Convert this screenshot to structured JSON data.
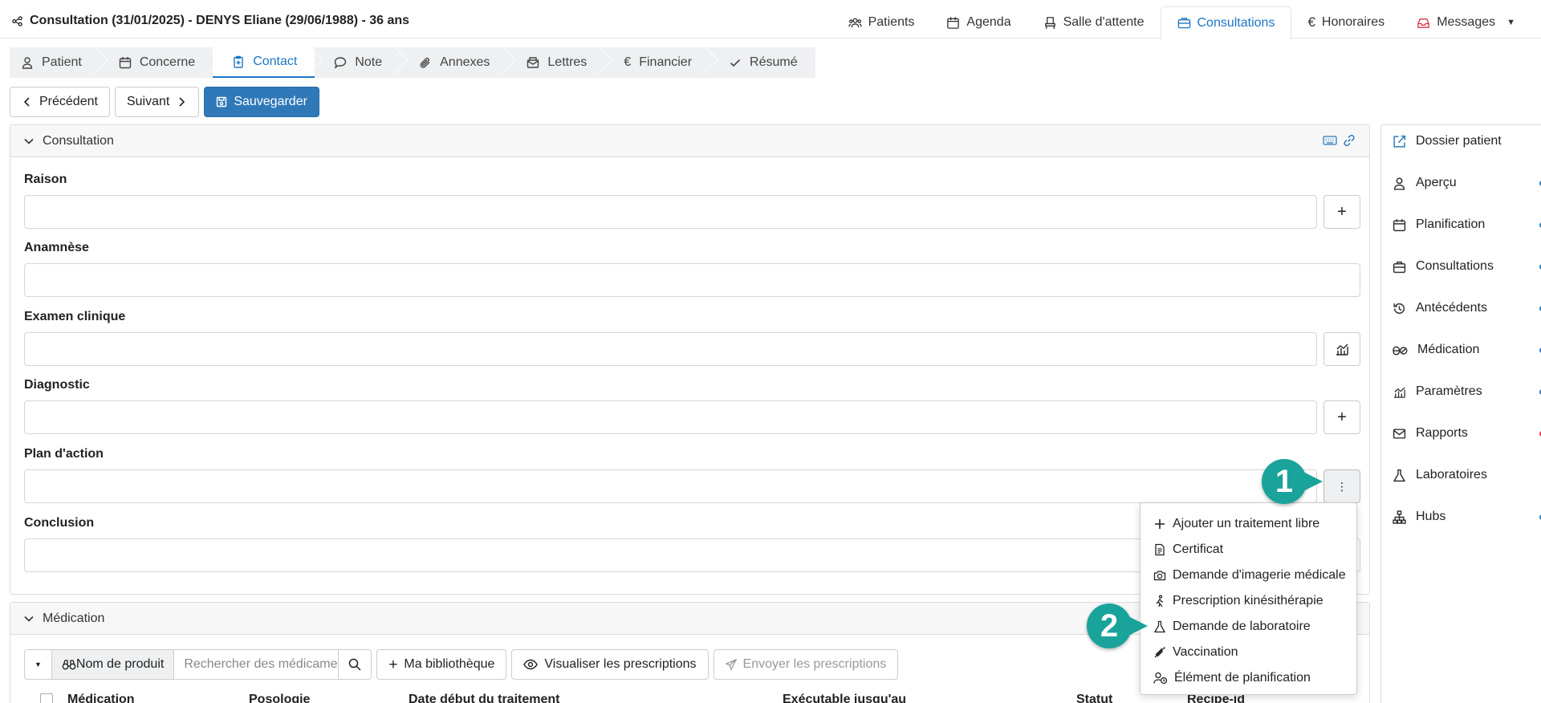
{
  "header": {
    "title": "Consultation (31/01/2025) - DENYS Eliane (29/06/1988) - 36 ans",
    "nav": [
      {
        "label": "Patients",
        "icon": "users-icon"
      },
      {
        "label": "Agenda",
        "icon": "calendar-icon"
      },
      {
        "label": "Salle d'attente",
        "icon": "chair-icon"
      },
      {
        "label": "Consultations",
        "icon": "briefcase-icon",
        "active": true
      },
      {
        "label": "Honoraires",
        "icon": "euro-icon"
      },
      {
        "label": "Messages",
        "icon": "inbox-icon"
      }
    ]
  },
  "subtabs": [
    {
      "label": "Patient"
    },
    {
      "label": "Concerne"
    },
    {
      "label": "Contact",
      "active": true
    },
    {
      "label": "Note"
    },
    {
      "label": "Annexes"
    },
    {
      "label": "Lettres"
    },
    {
      "label": "Financier"
    },
    {
      "label": "Résumé"
    }
  ],
  "actions": {
    "previous": "Précédent",
    "next": "Suivant",
    "save": "Sauvegarder"
  },
  "consultation": {
    "heading": "Consultation",
    "fields": {
      "raison": "Raison",
      "anamnese": "Anamnèse",
      "examen": "Examen clinique",
      "diagnostic": "Diagnostic",
      "plan": "Plan d'action",
      "conclusion": "Conclusion"
    },
    "plus": "+",
    "more": "⋮"
  },
  "menu": [
    "Ajouter un traitement libre",
    "Certificat",
    "Demande d'imagerie médicale",
    "Prescription kinésithérapie",
    "Demande de laboratoire",
    "Vaccination",
    "Élément de planification"
  ],
  "medication": {
    "heading": "Médication",
    "product_name": "Nom de produit",
    "search_placeholder": "Rechercher des médicaments",
    "library": "Ma bibliothèque",
    "view": "Visualiser les prescriptions",
    "send": "Envoyer les prescriptions",
    "columns": [
      "Médication",
      "Posologie",
      "Date début du traitement",
      "Exécutable jusqu'au",
      "Statut",
      "Recipe-id"
    ]
  },
  "sidebar": {
    "items": [
      {
        "label": "Dossier patient"
      },
      {
        "label": "Aperçu",
        "dot": "#2f79b9"
      },
      {
        "label": "Planification",
        "dot": "#2f79b9"
      },
      {
        "label": "Consultations",
        "dot": "#2f79b9"
      },
      {
        "label": "Antécédents",
        "dot": "#2f79b9"
      },
      {
        "label": "Médication",
        "dot": "#2f79b9"
      },
      {
        "label": "Paramètres",
        "dot": "#2f79b9"
      },
      {
        "label": "Rapports",
        "dot": "#dc3545"
      },
      {
        "label": "Laboratoires"
      },
      {
        "label": "Hubs",
        "dot": "#2f79b9"
      }
    ]
  },
  "callouts": {
    "one": "1",
    "two": "2"
  },
  "colors": {
    "accent": "#1c74c4",
    "primary_button": "#2f79b9",
    "callout": "#1aa39b"
  }
}
